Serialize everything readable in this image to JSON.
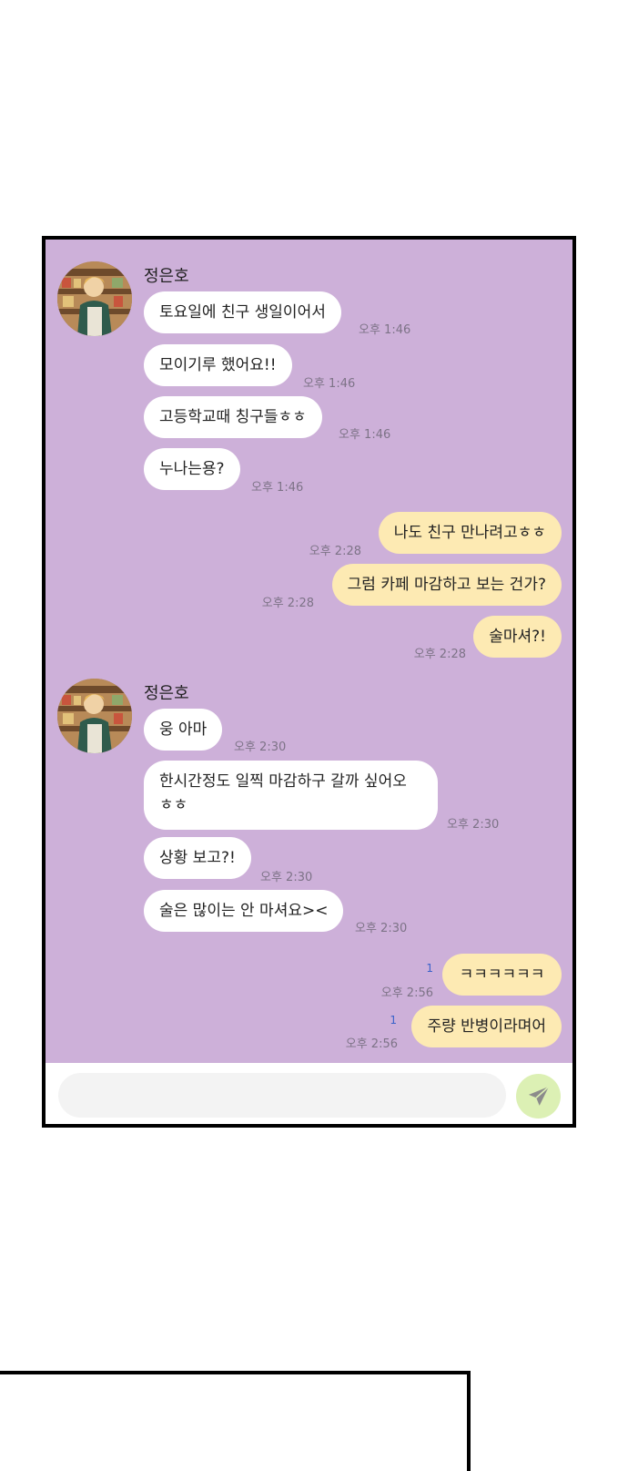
{
  "chat": {
    "sender_name_1": "정은호",
    "sender_name_2": "정은호",
    "messages": [
      {
        "text": "토요일에 친구 생일이어서",
        "time": "오후 1:46"
      },
      {
        "text": "모이기루 했어요!!",
        "time": "오후 1:46"
      },
      {
        "text": "고등학교때 칭구들ㅎㅎ",
        "time": "오후 1:46"
      },
      {
        "text": "누나는용?",
        "time": "오후 1:46"
      },
      {
        "text": "나도 친구 만나려고ㅎㅎ",
        "time": "오후 2:28"
      },
      {
        "text": "그럼 카페 마감하고 보는 건가?",
        "time": "오후 2:28"
      },
      {
        "text": "술마셔?!",
        "time": "오후 2:28"
      },
      {
        "text": "웅 아마",
        "time": "오후 2:30"
      },
      {
        "text": "한시간정도 일찍 마감하구 갈까 싶어오 ㅎㅎ",
        "time": "오후 2:30"
      },
      {
        "text": "상황 보고?!",
        "time": "오후 2:30"
      },
      {
        "text": "술은 많이는 안 마셔요><",
        "time": "오후 2:30"
      },
      {
        "text": "ㅋㅋㅋㅋㅋㅋ",
        "time": "오후 2:56",
        "unread": "1"
      },
      {
        "text": "주량 반병이라며어",
        "time": "오후 2:56",
        "unread": "1"
      }
    ]
  },
  "input": {
    "placeholder": "",
    "value": ""
  },
  "icons": {
    "avatar": "profile-avatar",
    "send": "send-icon"
  },
  "colors": {
    "background": "#cdb0d9",
    "incoming_bubble": "#ffffff",
    "outgoing_bubble": "#fdeab3",
    "send_button": "#dcf0b4"
  }
}
